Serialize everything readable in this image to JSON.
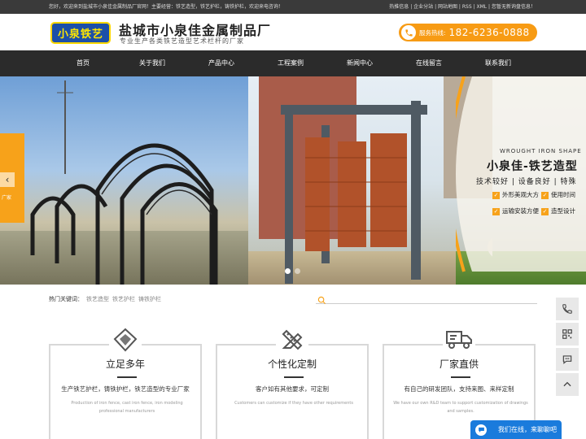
{
  "topbar": {
    "welcome": "您好，欢迎来到盐城市小泉佳金属制品厂官网！主要经营：铁艺造型，铁艺护栏，铸铁护栏，欢迎来电咨询！",
    "links": [
      "热推信息",
      "企业分站",
      "网站地图",
      "RSS",
      "XML",
      "您暂无新询盘信息！"
    ],
    "separator": " | "
  },
  "header": {
    "logo_text": "小泉铁艺",
    "company_name": "盐城市小泉佳金属制品厂",
    "tagline": "专业生产各类铁艺造型艺术栏杆的厂家",
    "hotline_label": "服务热线:",
    "hotline_number": "182-6236-0888"
  },
  "nav": {
    "items": [
      {
        "label": "首页"
      },
      {
        "label": "关于我们"
      },
      {
        "label": "产品中心"
      },
      {
        "label": "工程案例"
      },
      {
        "label": "新闻中心"
      },
      {
        "label": "在线留言"
      },
      {
        "label": "联系我们"
      }
    ]
  },
  "banner": {
    "left_tab_text": "广家",
    "title_en": "WROUGHT IRON SHAPE",
    "title": "小泉佳-铁艺造型",
    "subtitle": "技术较好 | 设备良好 | 特殊",
    "features": [
      "外形美观大方",
      "使用时间",
      "运输安装方便",
      "造型设计"
    ],
    "check_glyph": "✓",
    "arrow_glyph": "‹"
  },
  "search": {
    "keywords_label": "热门关键词：",
    "keywords": [
      "铁艺造型",
      "铁艺护栏",
      "铸铁护栏"
    ],
    "placeholder": ""
  },
  "cards": [
    {
      "icon": "diamond-icon",
      "title": "立足多年",
      "desc": "生产铁艺护栏，铸铁护栏，铁艺造型的专业厂家",
      "desc_en": "Production of iron fence, cast iron fence, iron modeling professional manufacturers"
    },
    {
      "icon": "pencil-ruler-icon",
      "title": "个性化定制",
      "desc": "客户如有其他要求，可定制",
      "desc_en": "Customers can customize if they have other requirements"
    },
    {
      "icon": "truck-icon",
      "title": "厂家直供",
      "desc": "有自己的研发团队，支持来图、来样定制",
      "desc_en": "We have our own R&D team to support customization of drawings and samples."
    }
  ],
  "side_tools": [
    "phone-icon",
    "qr-code-icon",
    "chat-icon",
    "back-to-top-icon"
  ],
  "chat": {
    "label": "我们在线，来聊聊吧"
  },
  "colors": {
    "accent": "#f7a21a",
    "nav_bg": "#2b2b2b",
    "topbar_bg": "#3a3a3a",
    "chat_blue": "#1a7bdc",
    "logo_blue": "#1c4fa8"
  }
}
